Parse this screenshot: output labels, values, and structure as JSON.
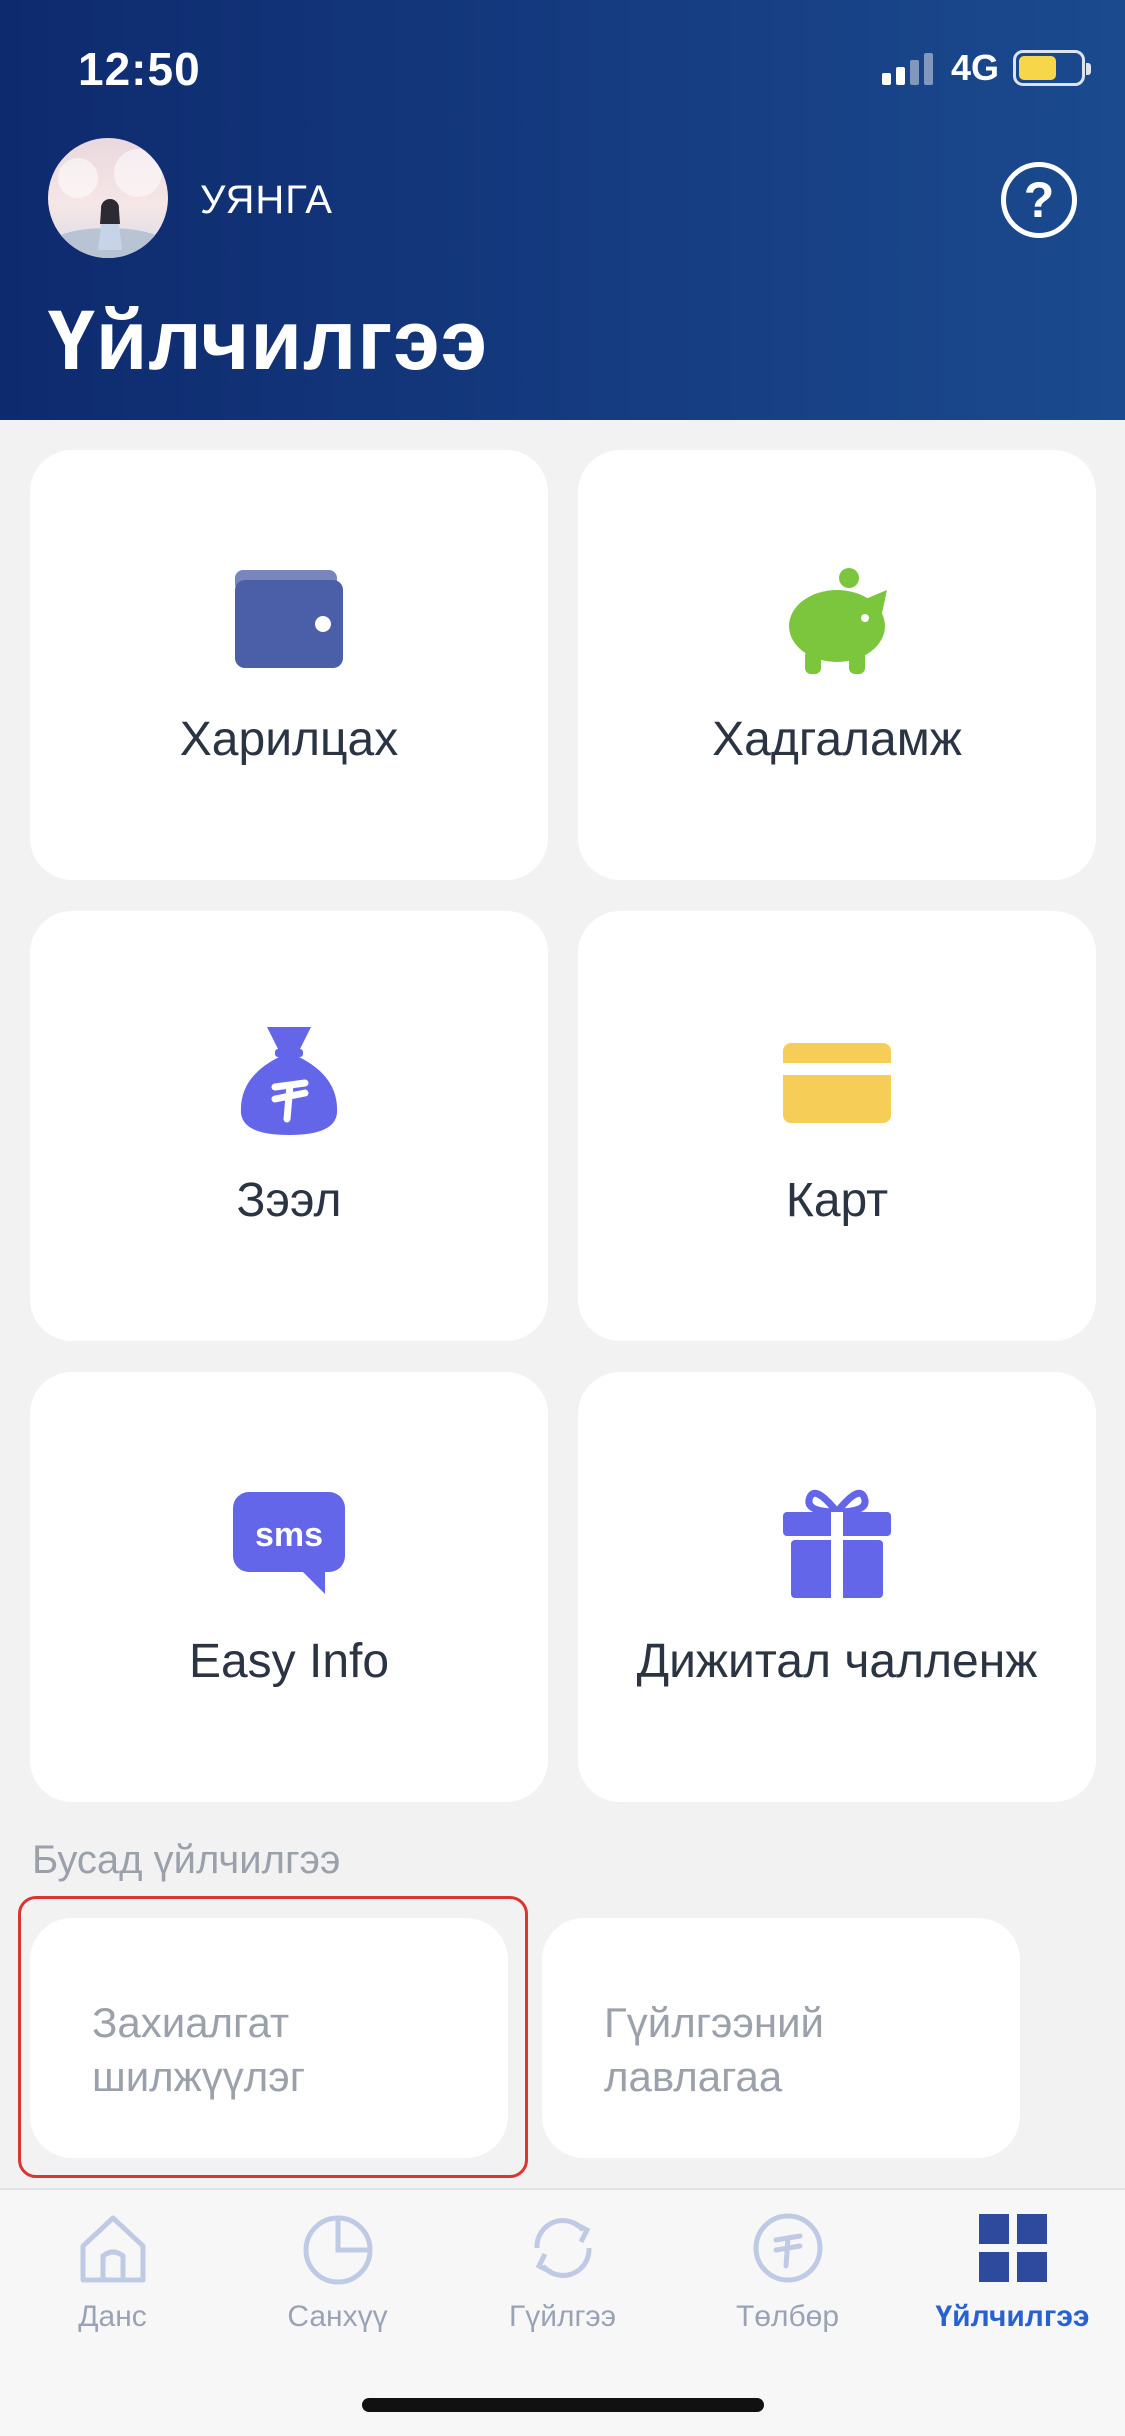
{
  "status_bar": {
    "time": "12:50",
    "network": "4G",
    "battery_level": 0.62
  },
  "header": {
    "username": "УЯНГА",
    "help_symbol": "?",
    "title": "Үйлчилгээ"
  },
  "services": [
    {
      "label": "Харилцах",
      "icon": "wallet-icon",
      "color": "#4a5fa8"
    },
    {
      "label": "Хадгаламж",
      "icon": "piggy-bank-icon",
      "color": "#7cc63e"
    },
    {
      "label": "Зээл",
      "icon": "money-bag-icon",
      "color": "#6366e8"
    },
    {
      "label": "Карт",
      "icon": "card-icon",
      "color": "#f5cd57"
    },
    {
      "label": "Easy Info",
      "icon": "sms-bubble-icon",
      "color": "#6366e8",
      "icon_text": "sms"
    },
    {
      "label": "Дижитал чалленж",
      "icon": "gift-icon",
      "color": "#6366e8"
    }
  ],
  "other_services": {
    "title": "Бусад үйлчилгээ",
    "items": [
      {
        "label": "Захиалгат\nшилжүүлэг",
        "highlighted": true
      },
      {
        "label": "Гүйлгээний\nлавлагаа",
        "highlighted": false
      }
    ]
  },
  "tabbar": {
    "items": [
      {
        "label": "Данс",
        "icon": "home-icon",
        "active": false
      },
      {
        "label": "Санхүү",
        "icon": "pie-chart-icon",
        "active": false
      },
      {
        "label": "Гүйлгээ",
        "icon": "refresh-icon",
        "active": false
      },
      {
        "label": "Төлбөр",
        "icon": "tugrik-coin-icon",
        "active": false
      },
      {
        "label": "Үйлчилгээ",
        "icon": "grid-icon",
        "active": true
      }
    ],
    "active_color": "#2762d1"
  }
}
